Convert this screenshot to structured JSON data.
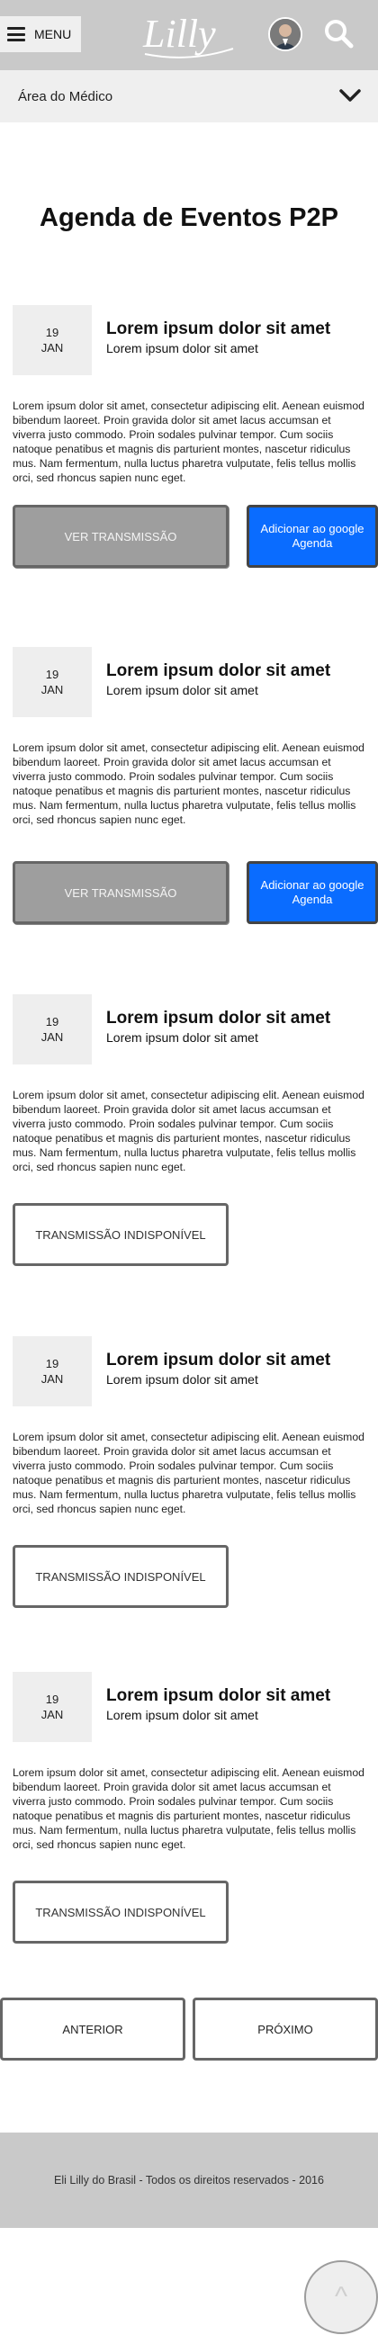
{
  "header": {
    "menu_label": "MENU",
    "logo_text": "Lilly"
  },
  "subnav": {
    "label": "Área do Médico"
  },
  "page": {
    "title": "Agenda de Eventos P2P"
  },
  "events": [
    {
      "day": "19",
      "month": "JAN",
      "title": "Lorem ipsum dolor sit amet",
      "subtitle": "Lorem ipsum dolor sit amet",
      "description": "Lorem ipsum dolor sit amet, consectetur adipiscing elit. Aenean euismod bibendum laoreet. Proin gravida dolor sit amet lacus accumsan et viverra justo commodo. Proin sodales pulvinar tempor. Cum sociis natoque penatibus et magnis dis parturient montes, nascetur ridiculus mus. Nam fermentum, nulla luctus pharetra vulputate, felis tellus mollis orci, sed rhoncus sapien nunc eget.",
      "watch_label": "VER TRANSMISSÃO",
      "google_label": "Adicionar ao google Agenda"
    },
    {
      "day": "19",
      "month": "JAN",
      "title": "Lorem ipsum dolor sit amet",
      "subtitle": "Lorem ipsum dolor sit amet",
      "description": "Lorem ipsum dolor sit amet, consectetur adipiscing elit. Aenean euismod bibendum laoreet. Proin gravida dolor sit amet lacus accumsan et viverra justo commodo. Proin sodales pulvinar tempor. Cum sociis natoque penatibus et magnis dis parturient montes, nascetur ridiculus mus. Nam fermentum, nulla luctus pharetra vulputate, felis tellus mollis orci, sed rhoncus sapien nunc eget.",
      "watch_label": "VER TRANSMISSÃO",
      "google_label": "Adicionar ao google Agenda"
    },
    {
      "day": "19",
      "month": "JAN",
      "title": "Lorem ipsum dolor sit amet",
      "subtitle": "Lorem ipsum dolor sit amet",
      "description": "Lorem ipsum dolor sit amet, consectetur adipiscing elit. Aenean euismod bibendum laoreet. Proin gravida dolor sit amet lacus accumsan et viverra justo commodo. Proin sodales pulvinar tempor. Cum sociis natoque penatibus et magnis dis parturient montes, nascetur ridiculus mus. Nam fermentum, nulla luctus pharetra vulputate, felis tellus mollis orci, sed rhoncus sapien nunc eget.",
      "unavailable_label": "TRANSMISSÃO INDISPONÍVEL"
    },
    {
      "day": "19",
      "month": "JAN",
      "title": "Lorem ipsum dolor sit amet",
      "subtitle": "Lorem ipsum dolor sit amet",
      "description": "Lorem ipsum dolor sit amet, consectetur adipiscing elit. Aenean euismod bibendum laoreet. Proin gravida dolor sit amet lacus accumsan et viverra justo commodo. Proin sodales pulvinar tempor. Cum sociis natoque penatibus et magnis dis parturient montes, nascetur ridiculus mus. Nam fermentum, nulla luctus pharetra vulputate, felis tellus mollis orci, sed rhoncus sapien nunc eget.",
      "unavailable_label": "TRANSMISSÃO INDISPONÍVEL"
    },
    {
      "day": "19",
      "month": "JAN",
      "title": "Lorem ipsum dolor sit amet",
      "subtitle": "Lorem ipsum dolor sit amet",
      "description": "Lorem ipsum dolor sit amet, consectetur adipiscing elit. Aenean euismod bibendum laoreet. Proin gravida dolor sit amet lacus accumsan et viverra justo commodo. Proin sodales pulvinar tempor. Cum sociis natoque penatibus et magnis dis parturient montes, nascetur ridiculus mus. Nam fermentum, nulla luctus pharetra vulputate, felis tellus mollis orci, sed rhoncus sapien nunc eget.",
      "unavailable_label": "TRANSMISSÃO INDISPONÍVEL"
    }
  ],
  "pagination": {
    "prev_label": "ANTERIOR",
    "next_label": "PRÓXIMO"
  },
  "footer": {
    "text": "Eli Lilly do Brasil - Todos os direitos reservados - 2016"
  },
  "back_to_top": {
    "glyph": "^"
  },
  "icons": {
    "menu": "hamburger-icon",
    "search": "search-icon",
    "chevron": "chevron-down-icon",
    "avatar": "user-avatar"
  },
  "colors": {
    "header_bg": "#c9c9c9",
    "google_button": "#0a6cff",
    "watch_button": "#9e9e9e"
  }
}
